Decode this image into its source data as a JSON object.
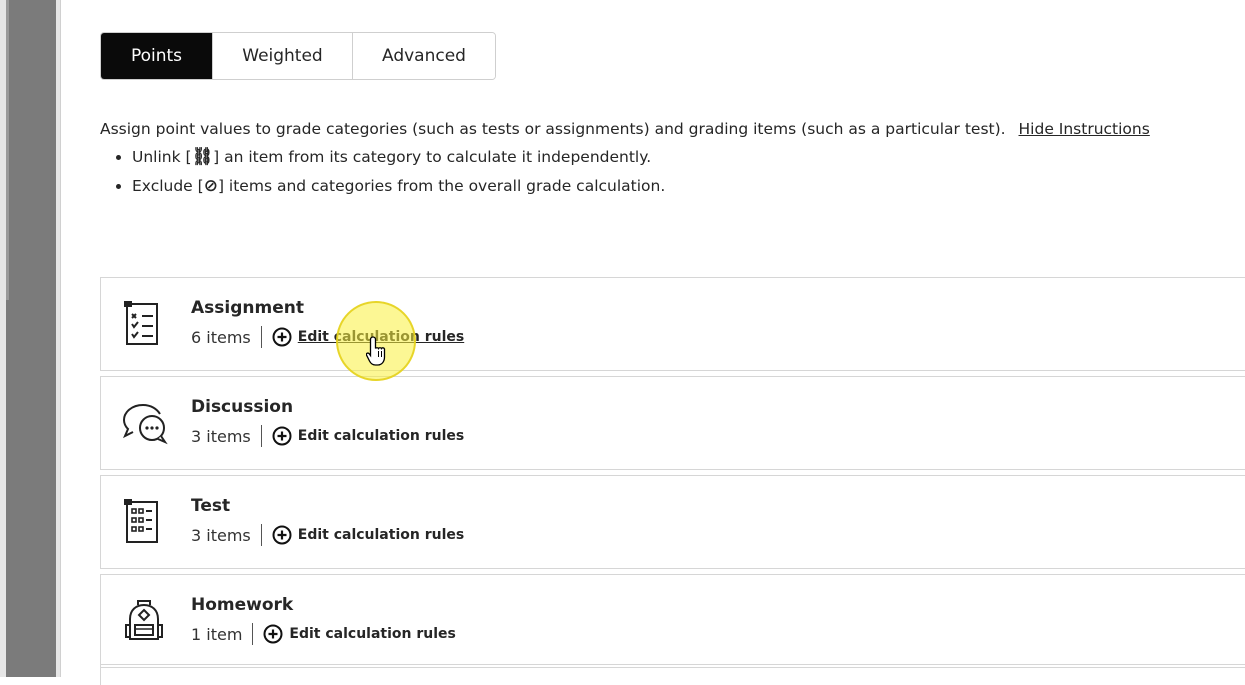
{
  "tabs": [
    {
      "label": "Points",
      "active": true
    },
    {
      "label": "Weighted",
      "active": false
    },
    {
      "label": "Advanced",
      "active": false
    }
  ],
  "instructions": {
    "text": "Assign point values to grade categories (such as tests or assignments) and grading items (such as a particular test).",
    "hide_link": "Hide Instructions",
    "bullet1_prefix": "Unlink [",
    "bullet1_glyph": "⛓",
    "bullet1_suffix": "] an item from its category to calculate it independently.",
    "bullet2_prefix": "Exclude [",
    "bullet2_glyph": "⊘",
    "bullet2_suffix": "] items and categories from the overall grade calculation."
  },
  "categories": [
    {
      "name": "Assignment",
      "count": "6 items",
      "edit_label": "Edit calculation rules",
      "icon": "assignment-checklist-icon"
    },
    {
      "name": "Discussion",
      "count": "3 items",
      "edit_label": "Edit calculation rules",
      "icon": "discussion-bubbles-icon"
    },
    {
      "name": "Test",
      "count": "3 items",
      "edit_label": "Edit calculation rules",
      "icon": "test-grid-icon"
    },
    {
      "name": "Homework",
      "count": "1 item",
      "edit_label": "Edit calculation rules",
      "icon": "backpack-icon"
    }
  ],
  "colors": {
    "active_tab_bg": "#0a0a0a",
    "rail": "#7b7b7b",
    "cursor_highlight": "#faf03c"
  }
}
